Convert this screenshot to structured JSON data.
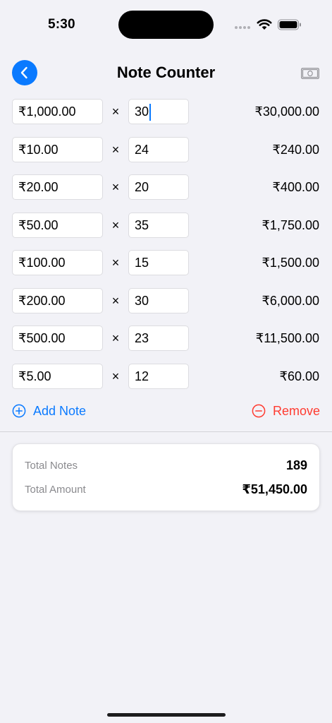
{
  "status_bar": {
    "time": "5:30"
  },
  "header": {
    "title": "Note Counter"
  },
  "notes": [
    {
      "denomination": "₹1,000.00",
      "quantity": "30",
      "total": "₹30,000.00"
    },
    {
      "denomination": "₹10.00",
      "quantity": "24",
      "total": "₹240.00"
    },
    {
      "denomination": "₹20.00",
      "quantity": "20",
      "total": "₹400.00"
    },
    {
      "denomination": "₹50.00",
      "quantity": "35",
      "total": "₹1,750.00"
    },
    {
      "denomination": "₹100.00",
      "quantity": "15",
      "total": "₹1,500.00"
    },
    {
      "denomination": "₹200.00",
      "quantity": "30",
      "total": "₹6,000.00"
    },
    {
      "denomination": "₹500.00",
      "quantity": "23",
      "total": "₹11,500.00"
    },
    {
      "denomination": "₹5.00",
      "quantity": "12",
      "total": "₹60.00"
    }
  ],
  "multiply_symbol": "×",
  "actions": {
    "add_label": "Add Note",
    "remove_label": "Remove"
  },
  "summary": {
    "total_notes_label": "Total Notes",
    "total_notes_value": "189",
    "total_amount_label": "Total Amount",
    "total_amount_value": "₹51,450.00"
  },
  "colors": {
    "accent": "#0a7aff",
    "destructive": "#ff3b30",
    "background": "#f2f2f7"
  },
  "icons": [
    "back-chevron-icon",
    "cash-icon",
    "add-circle-icon",
    "remove-circle-icon",
    "wifi-icon",
    "battery-icon",
    "cellular-icon"
  ]
}
